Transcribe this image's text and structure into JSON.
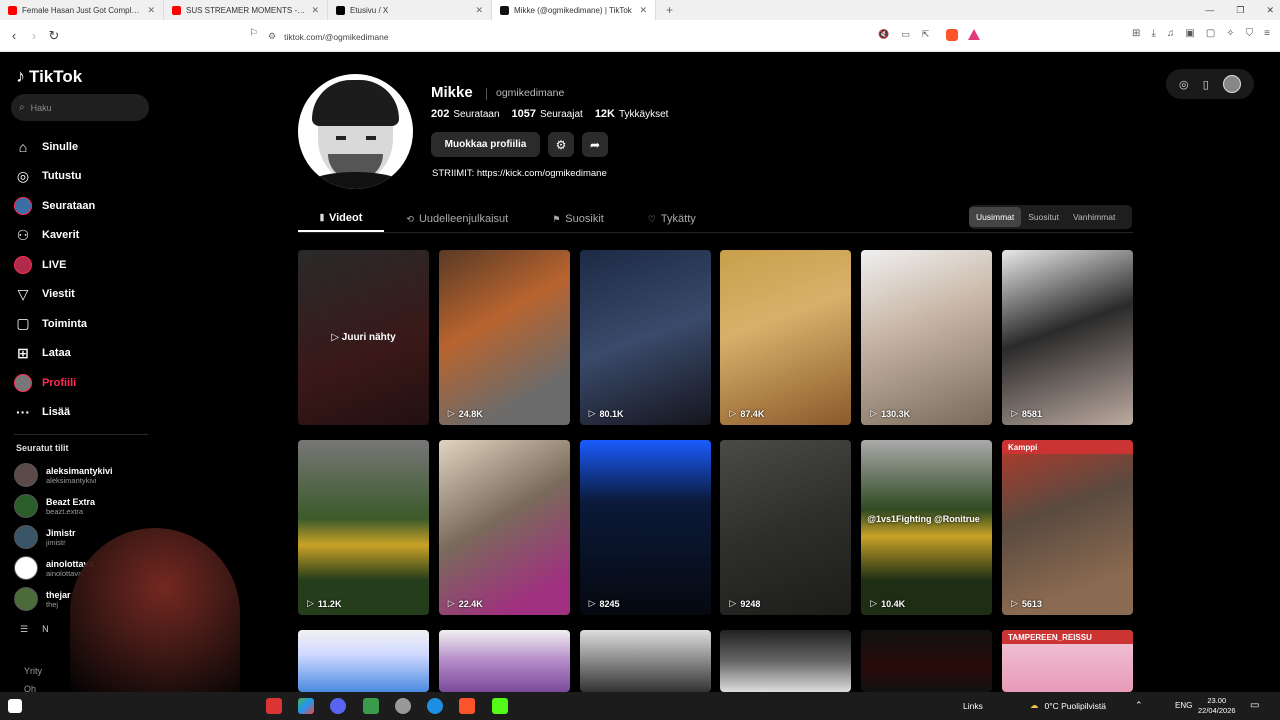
{
  "browser": {
    "tabs": [
      {
        "title": "Female Hasan Just Got Completely D",
        "color": "#ff0000"
      },
      {
        "title": "SUS STREAMER MOMENTS - YouTube",
        "color": "#ff0000"
      },
      {
        "title": "Etusivu / X",
        "color": "#000000"
      },
      {
        "title": "Mikke (@ogmikedimane) | TikTok",
        "color": "#111111",
        "active": true
      }
    ],
    "new_tab": "+",
    "url": "tiktok.com/@ogmikedimane"
  },
  "sidebar": {
    "logo": "TikTok",
    "search_placeholder": "Haku",
    "nav": [
      {
        "label": "Sinulle",
        "icon": "home-icon"
      },
      {
        "label": "Tutustu",
        "icon": "compass-icon"
      },
      {
        "label": "Seurataan",
        "icon": "following-icon"
      },
      {
        "label": "Kaverit",
        "icon": "friends-icon"
      },
      {
        "label": "LIVE",
        "icon": "live-icon"
      },
      {
        "label": "Viestit",
        "icon": "messages-icon"
      },
      {
        "label": "Toiminta",
        "icon": "activity-icon"
      },
      {
        "label": "Lataa",
        "icon": "upload-icon"
      },
      {
        "label": "Profiili",
        "icon": "profile-icon",
        "active": true
      },
      {
        "label": "Lisää",
        "icon": "more-icon"
      }
    ],
    "followed_title": "Seuratut tilit",
    "followed": [
      {
        "name": "aleksimantykivi",
        "handle": "aleksimantykivi",
        "color": "#5a4a48"
      },
      {
        "name": "Beazt Extra",
        "handle": "beazt.extra",
        "color": "#2b5d2b"
      },
      {
        "name": "Jimistr",
        "handle": "jimistr",
        "color": "#3a5568"
      },
      {
        "name": "ainolottava",
        "handle": "ainolottava",
        "color": "#ffffff"
      },
      {
        "name": "thejar",
        "handle": "thej",
        "color": "#4b6b3a"
      }
    ],
    "more_label": "N",
    "footer1": "Yrity",
    "footer2": "Oh"
  },
  "profile": {
    "name": "Mikke",
    "handle": "ogmikedimane",
    "following_count": "202",
    "following_label": "Seurataan",
    "followers_count": "1057",
    "followers_label": "Seuraajat",
    "likes_count": "12K",
    "likes_label": "Tykkäykset",
    "edit_button": "Muokkaa profiilia",
    "bio": "STRIIMIT: https://kick.com/ogmikedimane"
  },
  "tabs": [
    {
      "label": "Videot",
      "active": true
    },
    {
      "label": "Uudelleenjulkaisut"
    },
    {
      "label": "Suosikit"
    },
    {
      "label": "Tykätty"
    }
  ],
  "sort": [
    {
      "label": "Uusimmat",
      "active": true
    },
    {
      "label": "Suositut"
    },
    {
      "label": "Vanhimmat"
    }
  ],
  "videos": [
    {
      "views": "",
      "center": "▷ Juuri nähty",
      "bg": "linear-gradient(160deg,#2a2a2a,#3a1818 60%,#221010)"
    },
    {
      "views": "24.8K",
      "bg": "linear-gradient(150deg,#5a3a25,#b8642f 40%,#6b6b6b 80%)"
    },
    {
      "views": "80.1K",
      "bg": "linear-gradient(160deg,#1c2a45,#3a4a6a 50%,#15151e)"
    },
    {
      "views": "87.4K",
      "bg": "linear-gradient(160deg,#c8a04a,#d8b06a 40%,#8b5a2b)"
    },
    {
      "views": "130.3K",
      "bg": "linear-gradient(160deg,#f0f0f0,#c9b8a8 40%,#7a6a5a)"
    },
    {
      "views": "8581",
      "bg": "linear-gradient(160deg,#e8e8e8,#2a2a2a 45%,#bcaaa0)"
    },
    {
      "views": "11.2K",
      "bg": "linear-gradient(180deg,#777 0%,#3c5a2a 45%,#c9a227 60%,#253d1a 80%)"
    },
    {
      "views": "22.4K",
      "bg": "linear-gradient(150deg,#e0d4c0,#7a6a5a 45%,#a03080 85%)"
    },
    {
      "views": "8245",
      "bg": "linear-gradient(180deg,#1a5cff 0%,#0b1a3a 35%,#06080f 100%)"
    },
    {
      "views": "9248",
      "bg": "linear-gradient(160deg,#4a4a48,#2e2e2c 50%,#1c1c1a)"
    },
    {
      "views": "10.4K",
      "overlay": "@1vs1Fighting @Ronitrue",
      "bg": "linear-gradient(180deg,#aaa 0%,#2f4a22 40%,#c9a227 55%,#1e2e15 80%)"
    },
    {
      "views": "5613",
      "banner": "Kamppi",
      "bg": "linear-gradient(160deg,#b23a2a,#5a4a40 40%,#8a6a50 80%)"
    },
    {
      "views": "",
      "bg": "linear-gradient(180deg,#f2f2f2 0%,#cfd8ff 40%,#4a8ae0 100%)"
    },
    {
      "views": "",
      "bg": "linear-gradient(180deg,#f0f0f0 0%,#b48ac9 50%,#7a4a9a 100%)"
    },
    {
      "views": "",
      "bg": "linear-gradient(180deg,#ddd 0%,#888 50%,#333 100%)"
    },
    {
      "views": "",
      "bg": "linear-gradient(180deg,#222 0%,#666 50%,#ddd 100%)"
    },
    {
      "views": "",
      "bg": "linear-gradient(180deg,#111 0%,#2a0a0a 60%,#111 100%)"
    },
    {
      "views": "",
      "banner": "TAMPEREEN_REISSU",
      "bg": "linear-gradient(180deg,#f0c8d8 0%,#e89ab8 100%)"
    }
  ],
  "taskbar": {
    "links": "Links",
    "weather": "0°C  Puolipilvistä",
    "lang": "ENG",
    "time": "23.00",
    "date": "22/04/2026"
  }
}
